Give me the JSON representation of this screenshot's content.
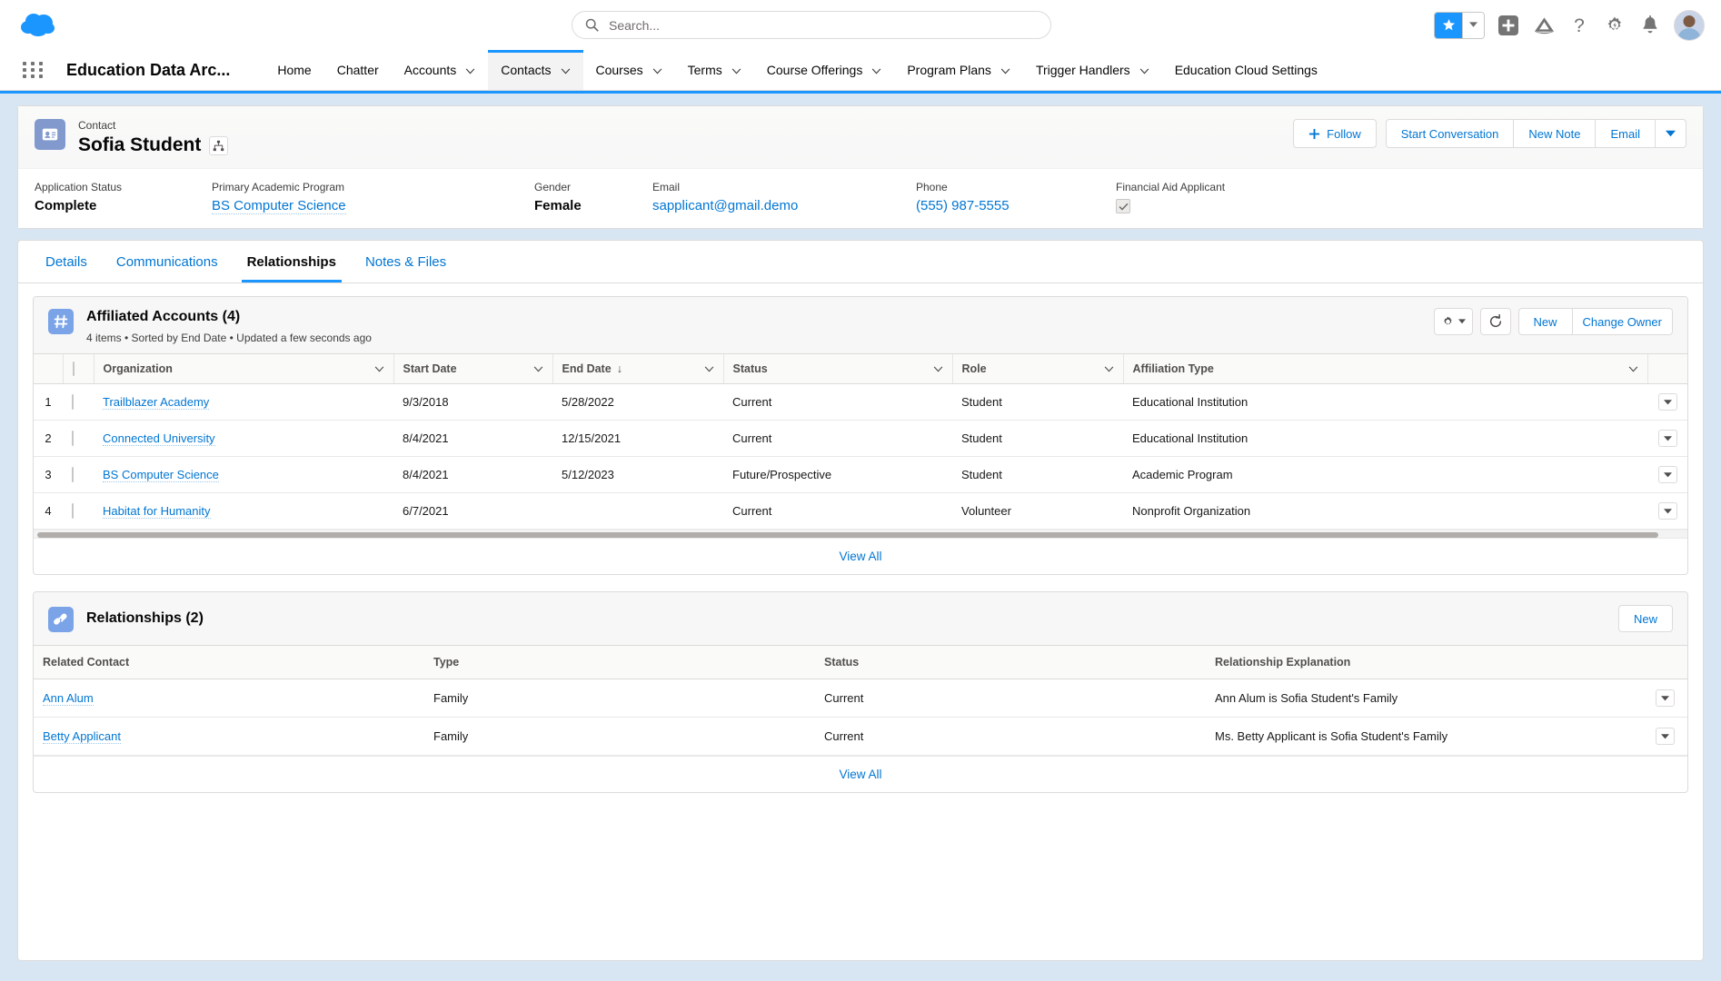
{
  "global_header": {
    "logo": "salesforce-cloud-logo",
    "search": {
      "placeholder": "Search...",
      "value": "",
      "icon": "search-icon"
    },
    "icons": [
      {
        "name": "favorites-star-icon",
        "glyph": "star"
      },
      {
        "name": "favorites-dropdown-icon",
        "glyph": "caret-down"
      },
      {
        "name": "global-create-icon",
        "glyph": "plus-square"
      },
      {
        "name": "trailhead-icon",
        "glyph": "mountain"
      },
      {
        "name": "help-icon",
        "glyph": "question-mark"
      },
      {
        "name": "setup-gear-icon",
        "glyph": "gear"
      },
      {
        "name": "notifications-bell-icon",
        "glyph": "bell"
      },
      {
        "name": "user-avatar",
        "glyph": "avatar"
      }
    ]
  },
  "nav": {
    "app_launcher": "app-launcher-waffle",
    "app_name": "Education Data Arc...",
    "items": [
      {
        "label": "Home",
        "has_caret": false,
        "active": false
      },
      {
        "label": "Chatter",
        "has_caret": false,
        "active": false
      },
      {
        "label": "Accounts",
        "has_caret": true,
        "active": false
      },
      {
        "label": "Contacts",
        "has_caret": true,
        "active": true
      },
      {
        "label": "Courses",
        "has_caret": true,
        "active": false
      },
      {
        "label": "Terms",
        "has_caret": true,
        "active": false
      },
      {
        "label": "Course Offerings",
        "has_caret": true,
        "active": false
      },
      {
        "label": "Program Plans",
        "has_caret": true,
        "active": false
      },
      {
        "label": "Trigger Handlers",
        "has_caret": true,
        "active": false
      },
      {
        "label": "Education Cloud Settings",
        "has_caret": false,
        "active": false
      }
    ]
  },
  "highlights": {
    "record_type": "Contact",
    "record_name": "Sofia Student",
    "record_icon": "contact-card-icon",
    "hierarchy_icon": "hierarchy-icon",
    "actions": {
      "follow": "Follow",
      "start_conversation": "Start Conversation",
      "new_note": "New Note",
      "email": "Email",
      "more": "caret-down-icon"
    },
    "fields": [
      {
        "label": "Application Status",
        "value": "Complete",
        "type": "text"
      },
      {
        "label": "Primary Academic Program",
        "value": "BS Computer Science",
        "type": "link"
      },
      {
        "label": "Gender",
        "value": "Female",
        "type": "text"
      },
      {
        "label": "Email",
        "value": "sapplicant@gmail.demo",
        "type": "link"
      },
      {
        "label": "Phone",
        "value": "(555) 987-5555",
        "type": "link"
      },
      {
        "label": "Financial Aid Applicant",
        "value": "",
        "type": "checkbox",
        "checked": true
      }
    ]
  },
  "tabs": [
    {
      "label": "Details",
      "active": false
    },
    {
      "label": "Communications",
      "active": false
    },
    {
      "label": "Relationships",
      "active": true
    },
    {
      "label": "Notes & Files",
      "active": false
    }
  ],
  "affiliated_accounts": {
    "icon": "affiliation-icon",
    "title": "Affiliated Accounts (4)",
    "subtitle": "4 items • Sorted by End Date • Updated a few seconds ago",
    "actions": {
      "settings": "gear-icon",
      "settings_caret": "caret-down-icon",
      "refresh": "refresh-icon",
      "new": "New",
      "change_owner": "Change Owner"
    },
    "columns": [
      {
        "label": "Organization",
        "sortable": true,
        "sorted": false
      },
      {
        "label": "Start Date",
        "sortable": true,
        "sorted": false
      },
      {
        "label": "End Date",
        "sortable": true,
        "sorted": true,
        "sort_dir": "↓"
      },
      {
        "label": "Status",
        "sortable": true,
        "sorted": false
      },
      {
        "label": "Role",
        "sortable": true,
        "sorted": false
      },
      {
        "label": "Affiliation Type",
        "sortable": true,
        "sorted": false
      }
    ],
    "rows": [
      {
        "num": "1",
        "organization": "Trailblazer Academy",
        "start_date": "9/3/2018",
        "end_date": "5/28/2022",
        "status": "Current",
        "role": "Student",
        "affiliation_type": "Educational Institution"
      },
      {
        "num": "2",
        "organization": "Connected University",
        "start_date": "8/4/2021",
        "end_date": "12/15/2021",
        "status": "Current",
        "role": "Student",
        "affiliation_type": "Educational Institution"
      },
      {
        "num": "3",
        "organization": "BS Computer Science",
        "start_date": "8/4/2021",
        "end_date": "5/12/2023",
        "status": "Future/Prospective",
        "role": "Student",
        "affiliation_type": "Academic Program"
      },
      {
        "num": "4",
        "organization": "Habitat for Humanity",
        "start_date": "6/7/2021",
        "end_date": "",
        "status": "Current",
        "role": "Volunteer",
        "affiliation_type": "Nonprofit Organization"
      }
    ],
    "view_all": "View All"
  },
  "relationships": {
    "icon": "relationship-icon",
    "title": "Relationships (2)",
    "actions": {
      "new": "New"
    },
    "columns": [
      {
        "label": "Related Contact"
      },
      {
        "label": "Type"
      },
      {
        "label": "Status"
      },
      {
        "label": "Relationship Explanation"
      }
    ],
    "rows": [
      {
        "related_contact": "Ann Alum",
        "type": "Family",
        "status": "Current",
        "explanation": "Ann Alum is Sofia Student's Family"
      },
      {
        "related_contact": "Betty Applicant",
        "type": "Family",
        "status": "Current",
        "explanation": "Ms. Betty Applicant is Sofia Student's Family"
      }
    ],
    "view_all": "View All"
  },
  "colors": {
    "brand_blue": "#0176d3",
    "accent_blue": "#1b96ff",
    "page_bg": "#d8e6f3",
    "text": "#181818",
    "icon_blue": "#7aa3e8"
  }
}
